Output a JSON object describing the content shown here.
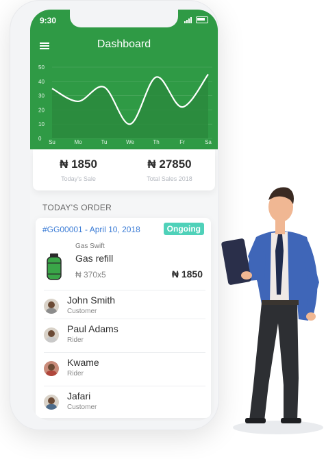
{
  "status_bar": {
    "time": "9:30"
  },
  "header": {
    "title": "Dashboard"
  },
  "chart_data": {
    "type": "area",
    "x": [
      "Su",
      "Mo",
      "Tu",
      "We",
      "Th",
      "Fr",
      "Sa"
    ],
    "values": [
      35,
      26,
      36,
      10,
      43,
      22,
      45
    ],
    "yticks": [
      0,
      10,
      20,
      30,
      40,
      50
    ],
    "ylim": [
      0,
      50
    ],
    "grid": true
  },
  "stats": [
    {
      "value": "₦ 1850",
      "label": "Today's Sale"
    },
    {
      "value": "₦ 27850",
      "label": "Total Sales 2018"
    }
  ],
  "orders_section": {
    "title": "TODAY'S ORDER"
  },
  "order": {
    "ref": "#GG00001",
    "date": "April 10, 2018",
    "status": "Ongoing",
    "vendor": "Gas Swift",
    "item": "Gas refill",
    "qty": "₦ 370x5",
    "price": "₦ 1850"
  },
  "people": [
    {
      "name": "John Smith",
      "role": "Customer"
    },
    {
      "name": "Paul Adams",
      "role": "Rider"
    },
    {
      "name": "Kwame",
      "role": "Rider"
    },
    {
      "name": "Jafari",
      "role": "Customer"
    }
  ],
  "colors": {
    "primary": "#2f9a45",
    "accent": "#3a7bd5",
    "badge": "#4fd1b9"
  },
  "icons": {
    "menu": "hamburger-icon",
    "product": "gas-cylinder-icon"
  }
}
